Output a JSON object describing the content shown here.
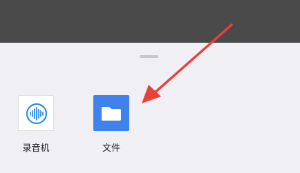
{
  "share_sheet": {
    "apps": [
      {
        "label": "录音机",
        "icon": "voice-recorder-icon"
      },
      {
        "label": "文件",
        "icon": "folder-icon"
      }
    ]
  },
  "annotation": {
    "type": "arrow",
    "points_to": "文件",
    "color": "#e8413c"
  },
  "colors": {
    "overlay": "#4a4a4a",
    "sheet_background": "#f0eff4",
    "files_icon_background": "#3f82ec",
    "recorder_waveform": "#2d8de0"
  }
}
